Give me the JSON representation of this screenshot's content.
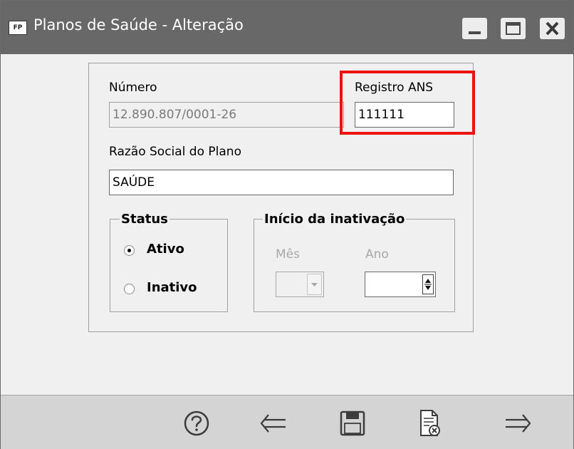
{
  "window": {
    "app_badge": "FP",
    "title": "Planos de Saúde - Alteração"
  },
  "form": {
    "numero_label": "Número",
    "numero_value": "12.890.807/0001-26",
    "registro_label": "Registro ANS",
    "registro_value": "111111",
    "razao_label": "Razão Social do Plano",
    "razao_value": "SAÚDE"
  },
  "status": {
    "title": "Status",
    "options": [
      {
        "label": "Ativo",
        "checked": true
      },
      {
        "label": "Inativo",
        "checked": false
      }
    ]
  },
  "inativacao": {
    "title": "Início da inativação",
    "mes_label": "Mês",
    "ano_label": "Ano",
    "mes_value": "",
    "ano_value": ""
  },
  "toolbar": {
    "icons": [
      "help-icon",
      "back-arrow-icon",
      "save-icon",
      "cancel-document-icon",
      "forward-arrow-icon"
    ]
  },
  "colors": {
    "titlebar": "#686868",
    "highlight": "#ee1111",
    "footer": "#d4d4d4"
  }
}
